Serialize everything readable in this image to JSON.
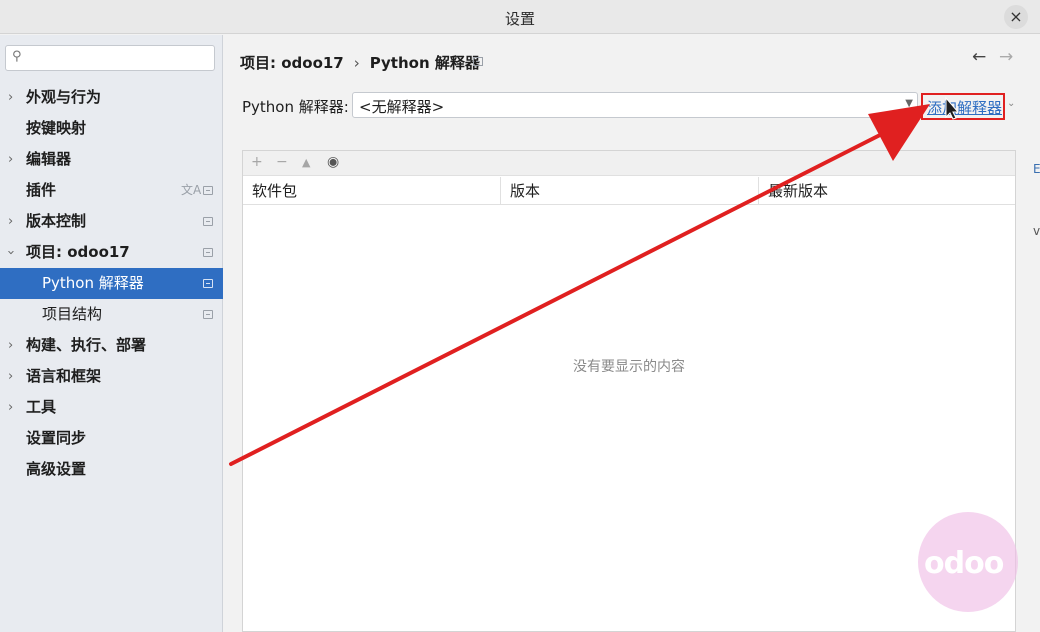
{
  "window": {
    "title": "设置"
  },
  "sidebar": {
    "search_placeholder": "",
    "items": [
      {
        "label": "外观与行为",
        "expandable": true
      },
      {
        "label": "按键映射",
        "expandable": false
      },
      {
        "label": "编辑器",
        "expandable": true
      },
      {
        "label": "插件",
        "expandable": false
      },
      {
        "label": "版本控制",
        "expandable": true
      },
      {
        "label": "项目: odoo17",
        "expandable": true,
        "expanded": true
      },
      {
        "label": "Python 解释器",
        "selected": true
      },
      {
        "label": "项目结构"
      },
      {
        "label": "构建、执行、部署",
        "expandable": true
      },
      {
        "label": "语言和框架",
        "expandable": true
      },
      {
        "label": "工具",
        "expandable": true
      },
      {
        "label": "设置同步",
        "expandable": false
      },
      {
        "label": "高级设置",
        "expandable": false
      }
    ]
  },
  "main": {
    "breadcrumb": {
      "parent": "项目: odoo17",
      "current": "Python 解释器"
    },
    "interpreter_label": "Python 解释器:",
    "interpreter_value": "<无解释器>",
    "add_interpreter": "添加解释器",
    "table": {
      "columns": [
        "软件包",
        "版本",
        "最新版本"
      ],
      "empty_text": "没有要显示的内容"
    }
  },
  "watermark": "odoo",
  "annotation_color": "#e02020",
  "accent_color": "#2f6ec2"
}
